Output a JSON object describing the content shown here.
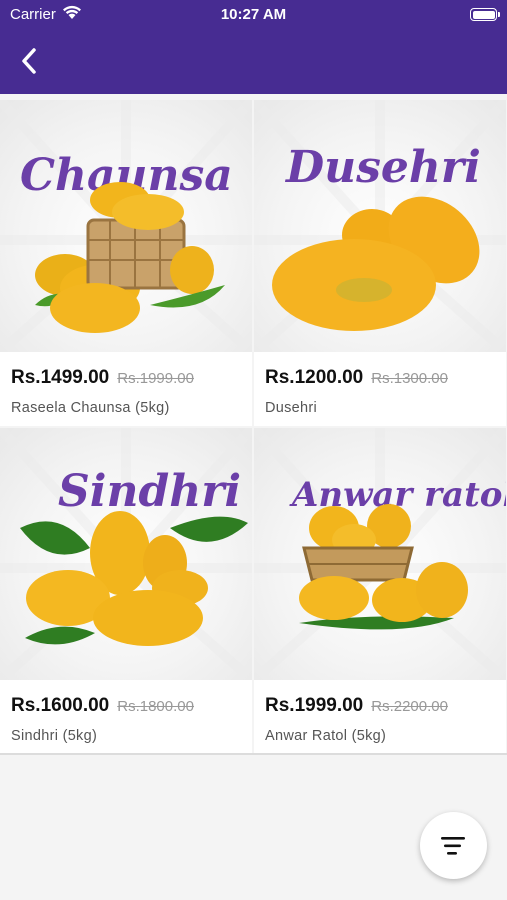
{
  "status_bar": {
    "carrier": "Carrier",
    "time": "10:27 AM"
  },
  "nav": {
    "back_icon": "chevron-left-icon"
  },
  "products": [
    {
      "image_title": "Chaunsa",
      "price": "Rs.1499.00",
      "old_price": "Rs.1999.00",
      "name": "Raseela Chaunsa (5kg)"
    },
    {
      "image_title": "Dusehri",
      "price": "Rs.1200.00",
      "old_price": "Rs.1300.00",
      "name": "Dusehri"
    },
    {
      "image_title": "Sindhri",
      "price": "Rs.1600.00",
      "old_price": "Rs.1800.00",
      "name": "Sindhri (5kg)"
    },
    {
      "image_title": "Anwar ratol",
      "price": "Rs.1999.00",
      "old_price": "Rs.2200.00",
      "name": "Anwar Ratol (5kg)"
    }
  ],
  "fab": {
    "icon": "sort-icon"
  },
  "colors": {
    "brand": "#472c92",
    "title_purple": "#6b3fa8",
    "mango": "#f2b51c"
  }
}
